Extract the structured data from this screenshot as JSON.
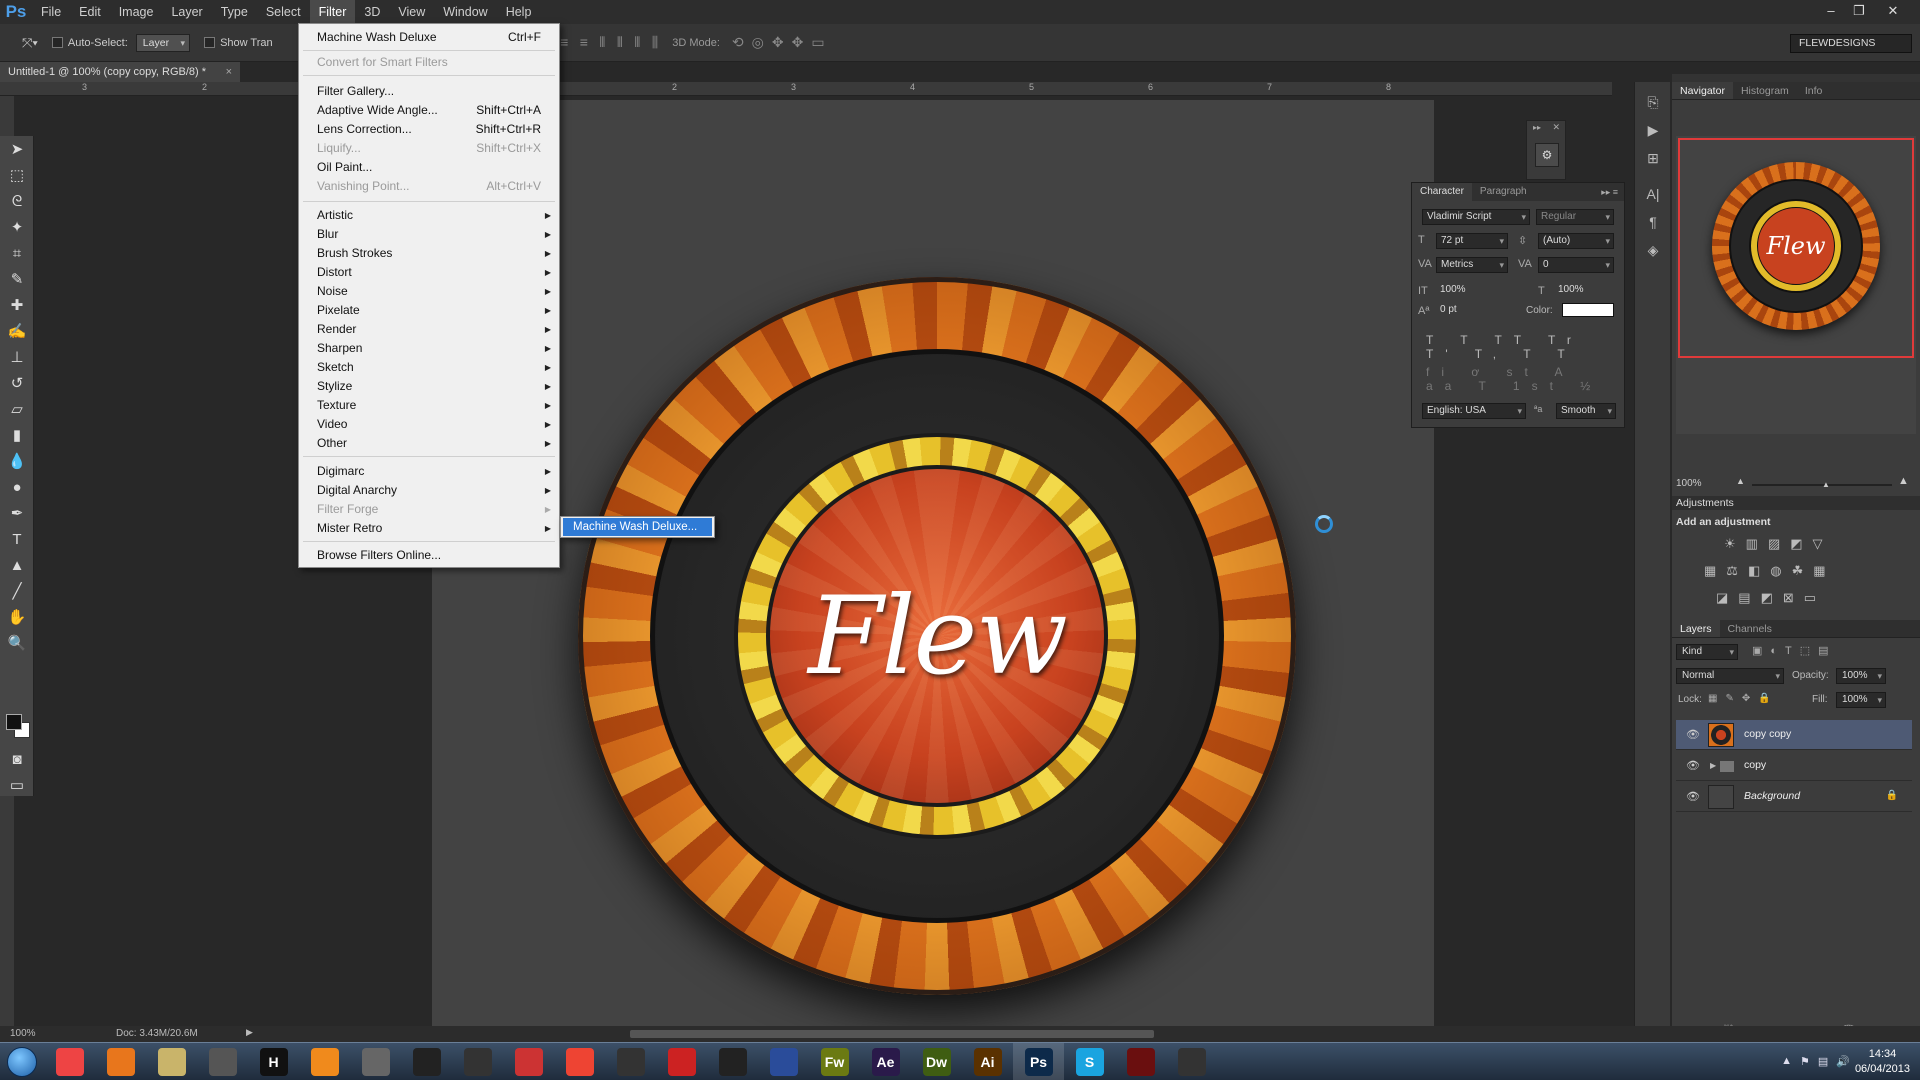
{
  "app": {
    "logo": "Ps"
  },
  "menubar": [
    "File",
    "Edit",
    "Image",
    "Layer",
    "Type",
    "Select",
    "Filter",
    "3D",
    "View",
    "Window",
    "Help"
  ],
  "options": {
    "auto_select": "Auto-Select:",
    "layer_select": "Layer",
    "show_transform": "Show Tran",
    "mode3d": "3D Mode:",
    "workspace": "FLEWDESIGNS"
  },
  "document": {
    "tab_title": "Untitled-1 @ 100% (copy copy, RGB/8) *",
    "artwork_text": "Flew"
  },
  "ruler": [
    "2",
    "3",
    "4",
    "5",
    "6",
    "7",
    "8"
  ],
  "ruler_left": [
    "3",
    "2"
  ],
  "filter_menu": {
    "last_filter": {
      "label": "Machine Wash Deluxe",
      "shortcut": "Ctrl+F"
    },
    "convert": "Convert for Smart Filters",
    "items": [
      {
        "label": "Filter Gallery...",
        "shortcut": ""
      },
      {
        "label": "Adaptive Wide Angle...",
        "shortcut": "Shift+Ctrl+A"
      },
      {
        "label": "Lens Correction...",
        "shortcut": "Shift+Ctrl+R"
      },
      {
        "label": "Liquify...",
        "shortcut": "Shift+Ctrl+X"
      },
      {
        "label": "Oil Paint...",
        "shortcut": ""
      },
      {
        "label": "Vanishing Point...",
        "shortcut": "Alt+Ctrl+V"
      }
    ],
    "groups": [
      "Artistic",
      "Blur",
      "Brush Strokes",
      "Distort",
      "Noise",
      "Pixelate",
      "Render",
      "Sharpen",
      "Sketch",
      "Stylize",
      "Texture",
      "Video",
      "Other"
    ],
    "plugins": [
      "Digimarc",
      "Digital Anarchy",
      "Filter Forge",
      "Mister Retro"
    ],
    "browse": "Browse Filters Online...",
    "submenu_item": "Machine Wash Deluxe..."
  },
  "character": {
    "tabs": [
      "Character",
      "Paragraph"
    ],
    "font": "Vladimir Script",
    "style": "Regular",
    "size": "72 pt",
    "leading": "(Auto)",
    "kerning": "Metrics",
    "tracking": "0",
    "vscale": "100%",
    "hscale": "100%",
    "baseline": "0 pt",
    "color_label": "Color:",
    "color": "#ffffff",
    "glyphs_row1": "T T TT Tr T' T, T T",
    "glyphs_row2": "fi ơ st A aa T 1st ½",
    "language": "English: USA",
    "aa_label": "ªa",
    "antialias": "Smooth"
  },
  "panels": {
    "navigator_tabs": [
      "Navigator",
      "Histogram",
      "Info"
    ],
    "navigator_preview_text": "Flew",
    "zoom": "100%",
    "adjustments_title": "Adjustments",
    "add_adjustment": "Add an adjustment",
    "layers_tabs": [
      "Layers",
      "Channels"
    ],
    "kind": "Kind",
    "blend_mode": "Normal",
    "opacity_label": "Opacity:",
    "opacity": "100%",
    "lock_label": "Lock:",
    "fill_label": "Fill:",
    "fill": "100%",
    "layers": [
      {
        "name": "copy copy",
        "selected": true
      },
      {
        "name": "copy",
        "selected": false
      },
      {
        "name": "Background",
        "selected": false
      }
    ]
  },
  "status": {
    "zoom": "100%",
    "doc": "Doc: 3.43M/20.6M"
  },
  "taskbar": {
    "apps": [
      {
        "label": "",
        "color": "#e44"
      },
      {
        "label": "",
        "color": "#e8761c"
      },
      {
        "label": "",
        "color": "#c9b46a"
      },
      {
        "label": "",
        "color": "#555"
      },
      {
        "label": "H",
        "color": "#111"
      },
      {
        "label": "",
        "color": "#f08a1c"
      },
      {
        "label": "",
        "color": "#666"
      },
      {
        "label": "",
        "color": "#222"
      },
      {
        "label": "",
        "color": "#333"
      },
      {
        "label": "",
        "color": "#c33"
      },
      {
        "label": "",
        "color": "#e43"
      },
      {
        "label": "",
        "color": "#333"
      },
      {
        "label": "",
        "color": "#c22"
      },
      {
        "label": "",
        "color": "#222"
      },
      {
        "label": "",
        "color": "#2a4c9a"
      },
      {
        "label": "Fw",
        "color": "#6b7a12"
      },
      {
        "label": "Ae",
        "color": "#2a1a4a"
      },
      {
        "label": "Dw",
        "color": "#3f5d12"
      },
      {
        "label": "Ai",
        "color": "#5a3100"
      },
      {
        "label": "Ps",
        "color": "#0d2a4a"
      },
      {
        "label": "S",
        "color": "#1aa4e0"
      },
      {
        "label": "",
        "color": "#6a0f0f"
      },
      {
        "label": "",
        "color": "#333"
      }
    ],
    "time": "14:34",
    "date": "06/04/2013"
  }
}
